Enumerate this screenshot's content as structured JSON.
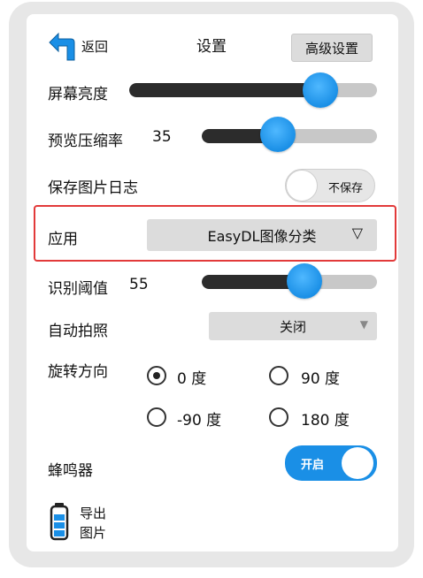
{
  "header": {
    "back_label": "返回",
    "title": "设置",
    "advanced_button": "高级设置"
  },
  "settings": {
    "brightness": {
      "label": "屏幕亮度",
      "value_fraction": 0.74
    },
    "preview_compression": {
      "label": "预览压缩率",
      "value": "35",
      "value_fraction": 0.39
    },
    "save_log": {
      "label": "保存图片日志",
      "toggle_text": "不保存",
      "on": false
    },
    "app": {
      "label": "应用",
      "selected": "EasyDL图像分类",
      "arrow": "▽"
    },
    "threshold": {
      "label": "识别阈值",
      "value": "55",
      "value_fraction": 0.58
    },
    "auto_capture": {
      "label": "自动拍照",
      "selected": "关闭",
      "arrow": "▼"
    },
    "rotation": {
      "label": "旋转方向",
      "options": [
        "0 度",
        "90 度",
        "-90 度",
        "180 度"
      ],
      "selected_index": 0
    },
    "buzzer": {
      "label": "蜂鸣器",
      "toggle_text": "开启",
      "on": true
    }
  },
  "footer": {
    "export_line1": "导出",
    "export_line2": "图片"
  },
  "colors": {
    "accent": "#1a8fe6",
    "track": "#c8c8c8",
    "fill": "#2c2c2c",
    "highlight_border": "#e23a3a",
    "button_gray": "#dcdcdc"
  },
  "icons": [
    "back-arrow-icon",
    "chevron-down-icon",
    "battery-icon"
  ]
}
